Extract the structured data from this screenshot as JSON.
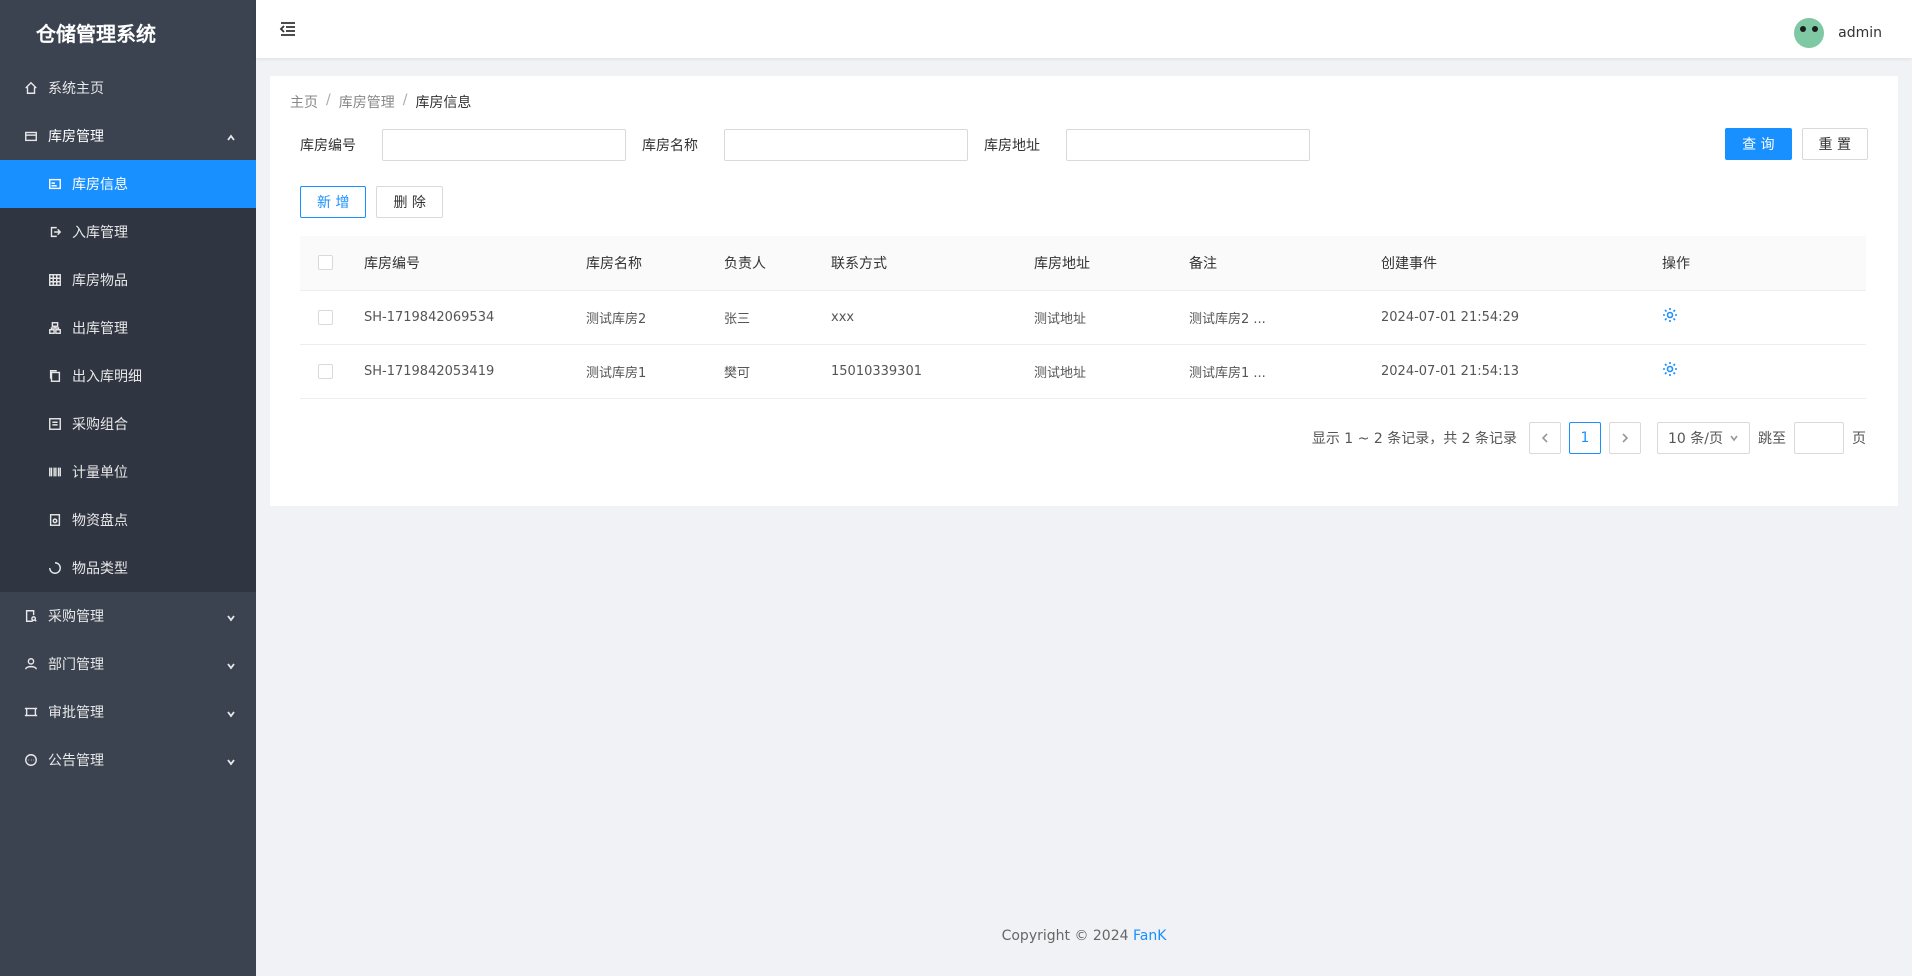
{
  "app": {
    "title": "仓储管理系统"
  },
  "sidebar": {
    "items": [
      {
        "label": "系统主页",
        "icon": "home-icon"
      },
      {
        "label": "库房管理",
        "icon": "box-icon",
        "open": true,
        "children": [
          {
            "label": "库房信息",
            "icon": "card-icon",
            "active": true
          },
          {
            "label": "入库管理",
            "icon": "login-icon"
          },
          {
            "label": "库房物品",
            "icon": "grid-icon"
          },
          {
            "label": "出库管理",
            "icon": "cluster-icon"
          },
          {
            "label": "出入库明细",
            "icon": "copy-icon"
          },
          {
            "label": "采购组合",
            "icon": "form-icon"
          },
          {
            "label": "计量单位",
            "icon": "barcode-icon"
          },
          {
            "label": "物资盘点",
            "icon": "audit-icon"
          },
          {
            "label": "物品类型",
            "icon": "loading-icon"
          }
        ]
      },
      {
        "label": "采购管理",
        "icon": "file-search-icon"
      },
      {
        "label": "部门管理",
        "icon": "user-icon"
      },
      {
        "label": "审批管理",
        "icon": "frame-icon"
      },
      {
        "label": "公告管理",
        "icon": "message-icon"
      }
    ]
  },
  "header": {
    "username": "admin"
  },
  "breadcrumb": [
    "主页",
    "库房管理",
    "库房信息"
  ],
  "search": {
    "code_label": "库房编号",
    "name_label": "库房名称",
    "address_label": "库房地址",
    "code_value": "",
    "name_value": "",
    "address_value": "",
    "query_label": "查 询",
    "reset_label": "重 置"
  },
  "actions": {
    "add_label": "新 增",
    "delete_label": "删 除"
  },
  "table": {
    "columns": [
      "库房编号",
      "库房名称",
      "负责人",
      "联系方式",
      "库房地址",
      "备注",
      "创建事件",
      "操作"
    ],
    "rows": [
      {
        "code": "SH-1719842069534",
        "name": "测试库房2",
        "manager": "张三",
        "contact": "xxx",
        "address": "测试地址",
        "remark": "测试库房2 ...",
        "created": "2024-07-01 21:54:29"
      },
      {
        "code": "SH-1719842053419",
        "name": "测试库房1",
        "manager": "樊可",
        "contact": "15010339301",
        "address": "测试地址",
        "remark": "测试库房1 ...",
        "created": "2024-07-01 21:54:13"
      }
    ]
  },
  "pagination": {
    "total_text": "显示 1 ~ 2 条记录，共 2 条记录",
    "current_page": "1",
    "page_size": "10 条/页",
    "jump_label": "跳至",
    "page_suffix": "页"
  },
  "footer": {
    "copyright": "Copyright © 2024",
    "brand": "FanK"
  },
  "colors": {
    "accent": "#1890ff",
    "sidebar_bg": "#3b4250",
    "submenu_bg": "#2f3541"
  }
}
